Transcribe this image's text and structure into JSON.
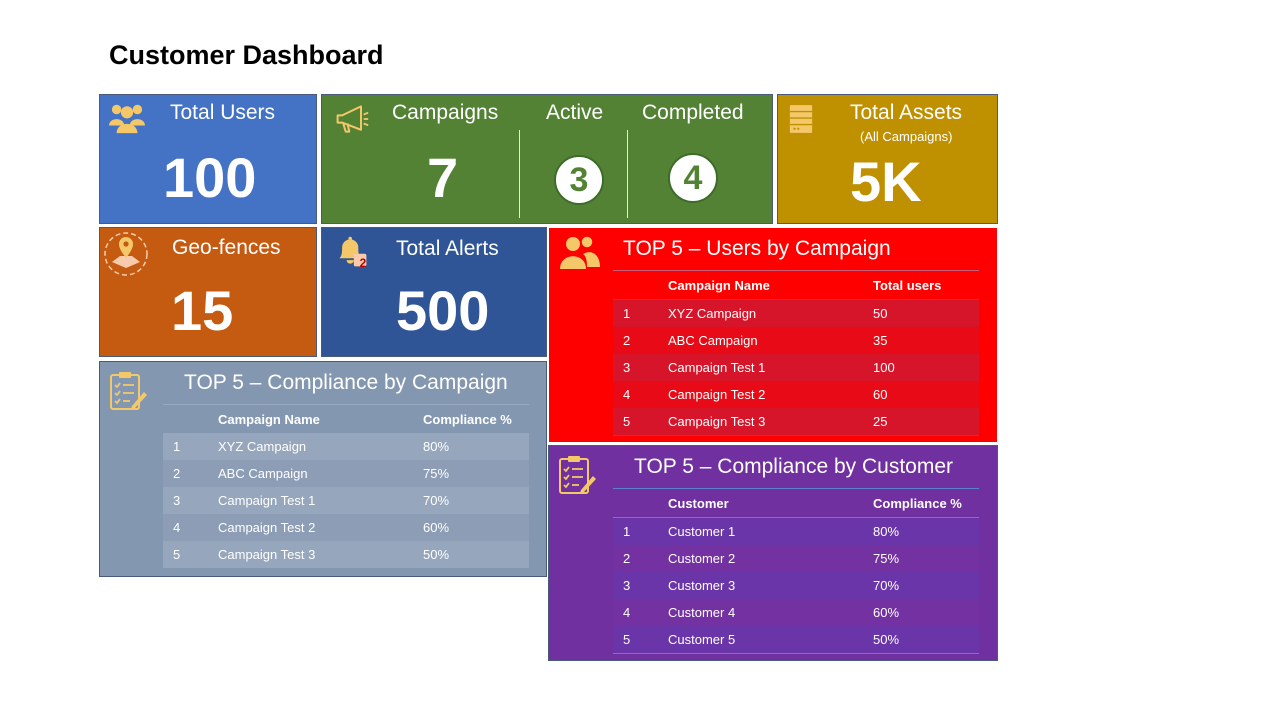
{
  "title": "Customer Dashboard",
  "colors": {
    "users": "#4472c4",
    "campaigns": "#548235",
    "assets": "#bf9000",
    "geofences": "#c55a11",
    "alerts": "#2f5597",
    "top_users": "#ff0000",
    "top_compliance_campaign": "#8497b0",
    "top_compliance_customer": "#7030a0",
    "icon_gold": "#f4c869"
  },
  "tiles": {
    "users": {
      "label": "Total Users",
      "value": "100",
      "icon": "users-icon"
    },
    "campaigns": {
      "label": "Campaigns",
      "value": "7",
      "icon": "megaphone-icon",
      "active_label": "Active",
      "active_value": "3",
      "completed_label": "Completed",
      "completed_value": "4"
    },
    "assets": {
      "label": "Total Assets",
      "sublabel": "(All Campaigns)",
      "value": "5K",
      "icon": "server-icon"
    },
    "geofences": {
      "label": "Geo-fences",
      "value": "15",
      "icon": "map-pin-icon"
    },
    "alerts": {
      "label": "Total Alerts",
      "value": "500",
      "icon": "bell-icon",
      "badge": "2"
    }
  },
  "top_users": {
    "title": "TOP 5 – Users by Campaign",
    "icon": "users-icon",
    "headers": [
      "",
      "Campaign Name",
      "Total users"
    ],
    "rows": [
      [
        "1",
        "XYZ Campaign",
        "50"
      ],
      [
        "2",
        "ABC Campaign",
        "35"
      ],
      [
        "3",
        "Campaign Test 1",
        "100"
      ],
      [
        "4",
        "Campaign Test 2",
        "60"
      ],
      [
        "5",
        "Campaign Test 3",
        "25"
      ]
    ]
  },
  "top_compliance_campaign": {
    "title": "TOP 5 – Compliance by Campaign",
    "icon": "checklist-icon",
    "headers": [
      "",
      "Campaign Name",
      "Compliance %"
    ],
    "rows": [
      [
        "1",
        "XYZ Campaign",
        "80%"
      ],
      [
        "2",
        "ABC Campaign",
        "75%"
      ],
      [
        "3",
        "Campaign Test 1",
        "70%"
      ],
      [
        "4",
        "Campaign Test 2",
        "60%"
      ],
      [
        "5",
        "Campaign Test 3",
        "50%"
      ]
    ]
  },
  "top_compliance_customer": {
    "title": "TOP 5 – Compliance by Customer",
    "icon": "checklist-icon",
    "headers": [
      "",
      "Customer",
      "Compliance %"
    ],
    "rows": [
      [
        "1",
        "Customer 1",
        "80%"
      ],
      [
        "2",
        "Customer 2",
        "75%"
      ],
      [
        "3",
        "Customer 3",
        "70%"
      ],
      [
        "4",
        "Customer 4",
        "60%"
      ],
      [
        "5",
        "Customer 5",
        "50%"
      ]
    ]
  }
}
